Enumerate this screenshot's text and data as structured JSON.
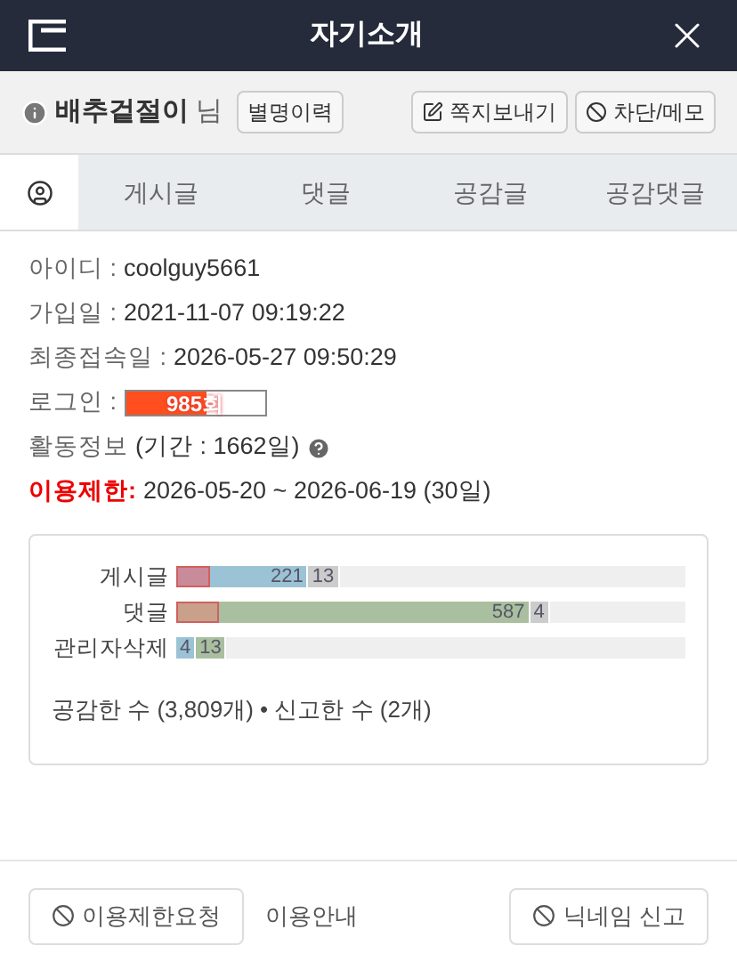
{
  "window": {
    "title": "자기소개"
  },
  "user": {
    "nickname": "배추겉절이",
    "suffix": "님",
    "history_button": "별명이력",
    "message_button": "쪽지보내기",
    "block_button": "차단/메모"
  },
  "tabs": [
    {
      "kind": "profile",
      "selected": true
    },
    {
      "label": "게시글",
      "selected": false
    },
    {
      "label": "댓글",
      "selected": false
    },
    {
      "label": "공감글",
      "selected": false
    },
    {
      "label": "공감댓글",
      "selected": false
    }
  ],
  "info": [
    {
      "label": "아이디 :",
      "value": "coolguy5661"
    },
    {
      "label": "가입일 :",
      "value": "2021-11-07 09:19:22"
    },
    {
      "label": "최종접속일 :",
      "value": "2026-05-27 09:50:29"
    }
  ],
  "login": {
    "label": "로그인 :",
    "count": "985회",
    "level": 0.58
  },
  "activity_info": {
    "label": "활동정보",
    "period": "(기간 : 1662일)"
  },
  "restriction": {
    "label": "이용제한:",
    "period": "2026-05-20 ~ 2026-06-19 (30일)"
  },
  "activity": {
    "rows": [
      {
        "label": "게시글",
        "segments": [
          {
            "kind": "overlay",
            "color": "#c98a9a",
            "level": 0.065
          },
          {
            "kind": "bar",
            "color": "#9cc3d5",
            "level": 0.26,
            "value": "221"
          },
          {
            "kind": "bar",
            "color": "#cccccc",
            "value": "13"
          }
        ]
      },
      {
        "label": "댓글",
        "segments": [
          {
            "kind": "overlay",
            "color": "#c9a08a",
            "level": 0.085
          },
          {
            "kind": "bar",
            "color": "#a9bf9f",
            "level": 0.695,
            "value": "587"
          },
          {
            "kind": "bar",
            "color": "#cccccc",
            "value": "4"
          }
        ]
      },
      {
        "label": "관리자삭제",
        "segments": [
          {
            "kind": "bar",
            "color": "#9cc3d5",
            "value": "4"
          },
          {
            "kind": "bar",
            "color": "#a9bf9f",
            "value": "13"
          }
        ]
      }
    ],
    "summary": "공감한 수 (3,809개) • 신고한 수 (2개)"
  },
  "footer": {
    "restrict_button": "이용제한요청",
    "guide_link": "이용안내",
    "report_button": "닉네임 신고"
  }
}
